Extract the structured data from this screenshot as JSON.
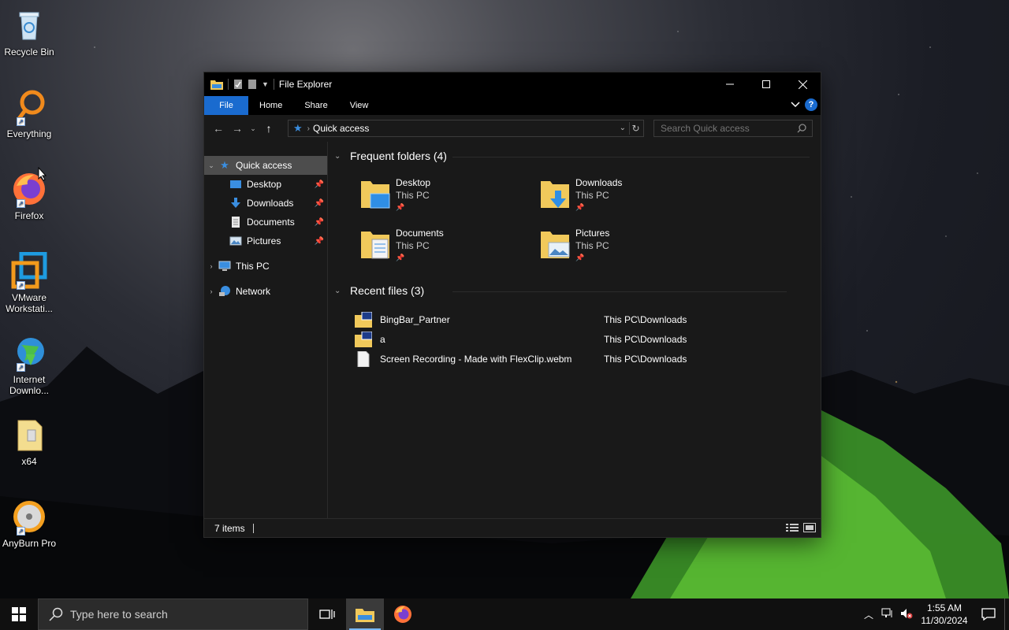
{
  "desktop": {
    "icons": [
      {
        "label": "Recycle Bin"
      },
      {
        "label": "Everything"
      },
      {
        "label": "Firefox"
      },
      {
        "label": "VMware Workstati..."
      },
      {
        "label": "Internet Downlo..."
      },
      {
        "label": "x64"
      },
      {
        "label": "AnyBurn Pro"
      }
    ]
  },
  "window": {
    "title": "File Explorer",
    "ribbon_tabs": [
      "File",
      "Home",
      "Share",
      "View"
    ],
    "address": {
      "crumb": "Quick access"
    },
    "search": {
      "placeholder": "Search Quick access"
    },
    "nav_pane": {
      "quick_access": "Quick access",
      "pinned": [
        {
          "label": "Desktop"
        },
        {
          "label": "Downloads"
        },
        {
          "label": "Documents"
        },
        {
          "label": "Pictures"
        }
      ],
      "this_pc": "This PC",
      "network": "Network"
    },
    "frequent": {
      "header": "Frequent folders (4)",
      "items": [
        {
          "name": "Desktop",
          "location": "This PC"
        },
        {
          "name": "Downloads",
          "location": "This PC"
        },
        {
          "name": "Documents",
          "location": "This PC"
        },
        {
          "name": "Pictures",
          "location": "This PC"
        }
      ]
    },
    "recent": {
      "header": "Recent files (3)",
      "items": [
        {
          "name": "BingBar_Partner",
          "path": "This PC\\Downloads"
        },
        {
          "name": "a",
          "path": "This PC\\Downloads"
        },
        {
          "name": "Screen Recording - Made with FlexClip.webm",
          "path": "This PC\\Downloads"
        }
      ]
    },
    "status": {
      "items": "7 items"
    }
  },
  "taskbar": {
    "search_placeholder": "Type here to search",
    "time": "1:55 AM",
    "date": "11/30/2024"
  },
  "colors": {
    "accent": "#1a6bcf",
    "window_bg": "#191919",
    "selection": "#4d4d4d"
  }
}
